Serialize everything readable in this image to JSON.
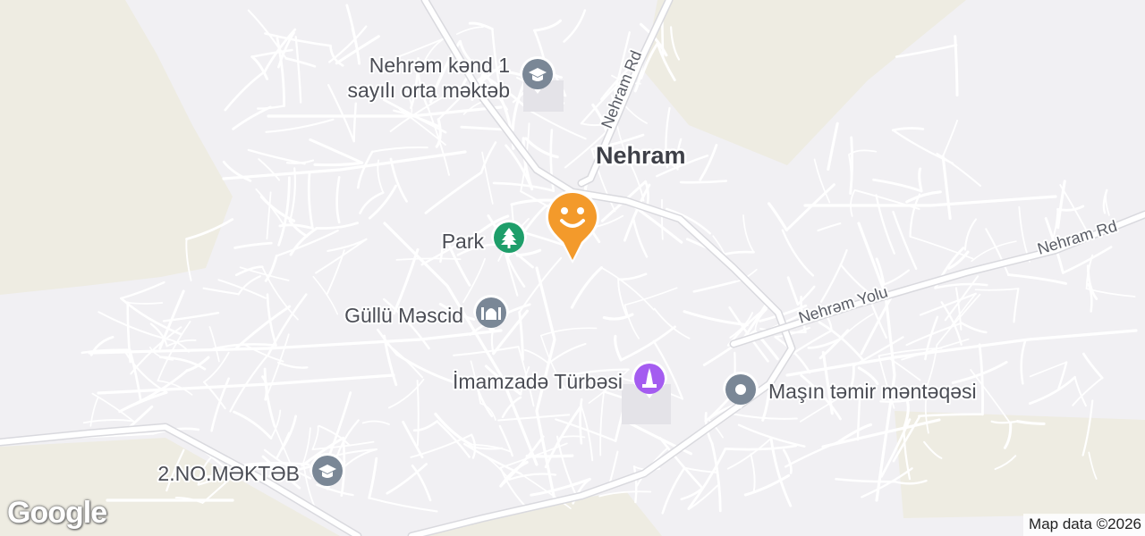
{
  "map": {
    "colors": {
      "background": "#f1f0f3",
      "farmland": "#eeece2",
      "street": "#ffffff",
      "main_road": "#ffffff",
      "school_pin": "#7a8796",
      "park_pin": "#1e9e6a",
      "mosque_pin": "#7a8796",
      "monument_pin": "#a45cf0",
      "generic_pin": "#7a8796",
      "location_pin": "#f39a2b"
    },
    "city": {
      "label": "Nehram"
    },
    "roads": [
      {
        "id": "nehram-rd-north",
        "label": "Nehram Rd"
      },
      {
        "id": "nehram-rd-east",
        "label": "Nehram Rd"
      },
      {
        "id": "nehram-yolu",
        "label": "Nehrəm Yolu"
      }
    ],
    "pois": [
      {
        "id": "school-1",
        "label_line1": "Nehrəm kənd 1",
        "label_line2": "sayılı orta məktəb",
        "icon": "school-icon"
      },
      {
        "id": "park",
        "label": "Park",
        "icon": "tree-icon"
      },
      {
        "id": "mosque",
        "label": "Güllü Məscid",
        "icon": "mosque-icon"
      },
      {
        "id": "mausoleum",
        "label": "İmamzadə Türbəsi",
        "icon": "monument-icon"
      },
      {
        "id": "repair",
        "label": "Maşın təmir məntəqəsi",
        "icon": "pin-dot-icon"
      },
      {
        "id": "school-2",
        "label": "2.NO.MƏKTƏB",
        "icon": "school-icon"
      }
    ],
    "selected_pin": {
      "icon": "smiley-icon"
    }
  },
  "footer": {
    "logo": "Google",
    "attribution": "Map data ©2026"
  }
}
